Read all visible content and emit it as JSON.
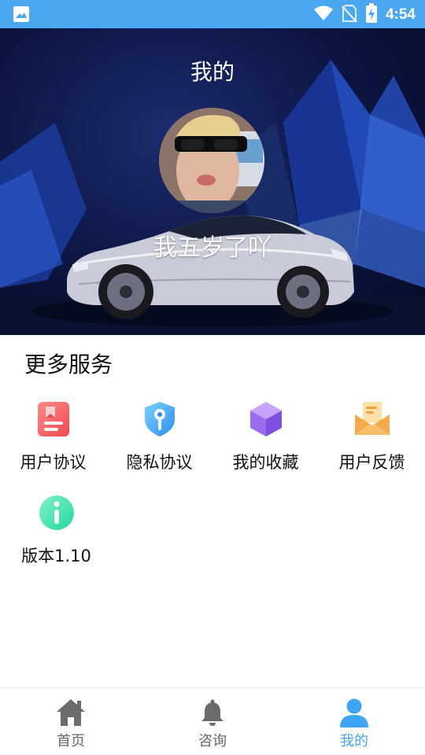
{
  "status_bar": {
    "time": "4:54"
  },
  "header": {
    "title": "我的"
  },
  "profile": {
    "nickname": "我五岁了吖"
  },
  "services": {
    "title": "更多服务",
    "items": [
      {
        "label": "用户协议",
        "icon": "document-icon"
      },
      {
        "label": "隐私协议",
        "icon": "shield-key-icon"
      },
      {
        "label": "我的收藏",
        "icon": "cube-icon"
      },
      {
        "label": "用户反馈",
        "icon": "envelope-icon"
      },
      {
        "label": "版本1.10",
        "icon": "info-icon"
      }
    ]
  },
  "tabs": [
    {
      "label": "首页",
      "icon": "home-icon"
    },
    {
      "label": "咨询",
      "icon": "bell-icon"
    },
    {
      "label": "我的",
      "icon": "person-icon",
      "active": true
    }
  ],
  "colors": {
    "accent": "#3ea5f5",
    "status_bar": "#4aa8f2"
  }
}
